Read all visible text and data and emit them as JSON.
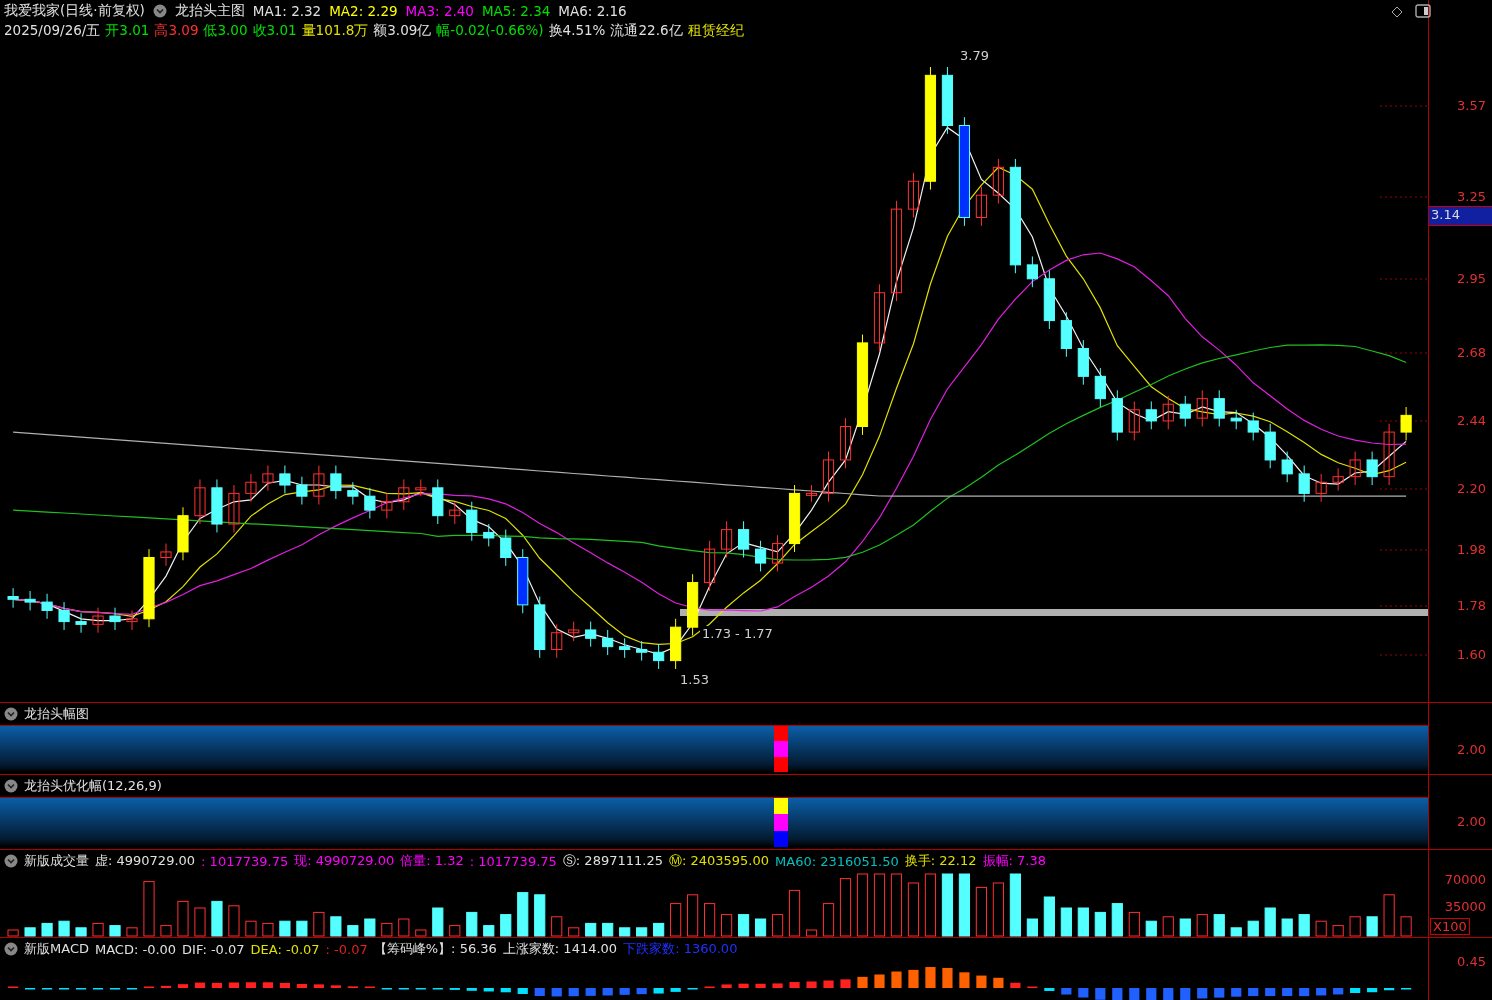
{
  "main_panel": {
    "title": "我爱我家(日线·前复权)",
    "indicator": "龙抬头主图",
    "ma_values": [
      {
        "text": "MA1: 2.32",
        "color": "#e0e0e0"
      },
      {
        "text": "MA2: 2.29",
        "color": "#ffff00"
      },
      {
        "text": "MA3: 2.40",
        "color": "#ff00ff"
      },
      {
        "text": "MA5: 2.34",
        "color": "#00e000"
      },
      {
        "text": "MA6: 2.16",
        "color": "#e0e0e0"
      }
    ],
    "quote": [
      {
        "text": "2025/09/26/五",
        "color": "#e0e0e0"
      },
      {
        "text": "开3.01",
        "color": "#00e000"
      },
      {
        "text": "高3.09",
        "color": "#ff3030"
      },
      {
        "text": "低3.00",
        "color": "#00e000"
      },
      {
        "text": "收3.01",
        "color": "#00e000"
      },
      {
        "text": "量101.8万",
        "color": "#e0e000"
      },
      {
        "text": "额3.09亿",
        "color": "#e0e0e0"
      },
      {
        "text": "幅-0.02(-0.66%)",
        "color": "#00e000"
      },
      {
        "text": "换4.51%",
        "color": "#e0e0e0"
      },
      {
        "text": "流通22.6亿",
        "color": "#e0e0e0"
      },
      {
        "text": "租赁经纪",
        "color": "#e0e000"
      }
    ],
    "annotations": [
      "3.79",
      "1.73 - 1.77",
      "1.53"
    ],
    "y_ticks": [
      "3.57",
      "3.25",
      "2.95",
      "2.68",
      "2.44",
      "2.20",
      "1.98",
      "1.78",
      "1.60"
    ],
    "price_tag": "3.14"
  },
  "signal_panels": [
    {
      "title": "龙抬头幅图",
      "y_tick": "2.00",
      "segments": [
        {
          "color": "#ff0000"
        },
        {
          "color": "#ff00ff"
        },
        {
          "color": "#ff0000"
        }
      ]
    },
    {
      "title": "龙抬头优化幅(12,26,9)",
      "y_tick": "2.00",
      "segments": [
        {
          "color": "#ffff00"
        },
        {
          "color": "#ff00ff"
        },
        {
          "color": "#0000ff"
        }
      ]
    }
  ],
  "volume_panel": {
    "title": "新版成交量",
    "values": [
      {
        "text": "虚: 4990729.00",
        "color": "#e0e0e0"
      },
      {
        "text": ": 1017739.75",
        "color": "#ff00ff"
      },
      {
        "text": "现: 4990729.00",
        "color": "#ff00ff"
      },
      {
        "text": "倍量: 1.32",
        "color": "#ff00ff"
      },
      {
        "text": ": 1017739.75",
        "color": "#ff00ff"
      },
      {
        "text": "Ⓢ: 2897111.25",
        "color": "#e0e0e0"
      },
      {
        "text": "Ⓜ: 2403595.00",
        "color": "#e0e000"
      },
      {
        "text": "MA60: 2316051.50",
        "color": "#00c0c0"
      },
      {
        "text": "换手: 22.12",
        "color": "#e0e000"
      },
      {
        "text": "振幅: 7.38",
        "color": "#ff00ff"
      }
    ],
    "y_ticks": [
      "70000",
      "35000"
    ],
    "scale_label": "X100"
  },
  "macd_panel": {
    "title": "新版MACD",
    "values": [
      {
        "text": "MACD: -0.00",
        "color": "#e0e0e0"
      },
      {
        "text": "DIF: -0.07",
        "color": "#e0e0e0"
      },
      {
        "text": "DEA: -0.07",
        "color": "#e0e000"
      },
      {
        "text": ": -0.07",
        "color": "#e02020"
      },
      {
        "text": "【筹码峰%】: 56.36",
        "color": "#e0e0e0"
      },
      {
        "text": "上涨家数: 1414.00",
        "color": "#e0e0e0"
      },
      {
        "text": "下跌家数: 1360.00",
        "color": "#2030ff"
      }
    ],
    "y_tick": "0.45"
  }
}
